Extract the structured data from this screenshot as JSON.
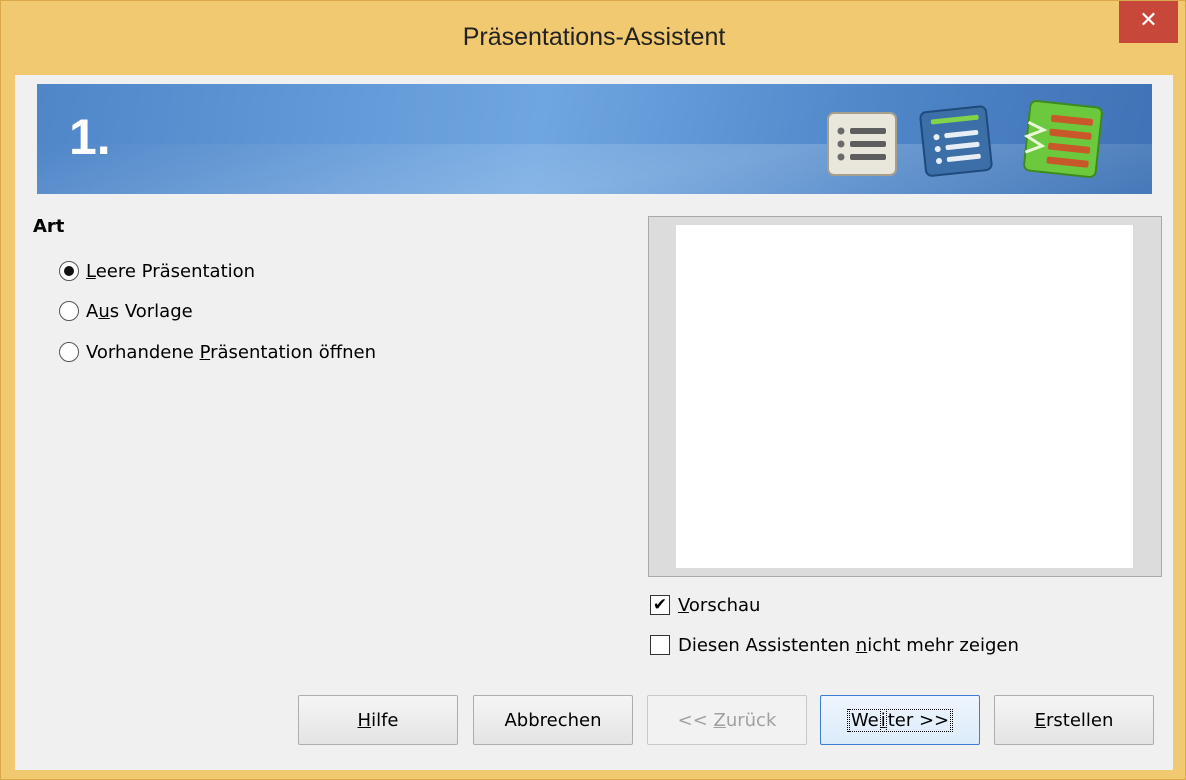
{
  "window": {
    "title": "Präsentations-Assistent",
    "close_glyph": "✕"
  },
  "banner": {
    "step_number": "1."
  },
  "type_section": {
    "label": "Art",
    "options": [
      {
        "pre": "",
        "mnemonic": "L",
        "post": "eere Präsentation",
        "checked": true
      },
      {
        "pre": "A",
        "mnemonic": "u",
        "post": "s Vorlage",
        "checked": false
      },
      {
        "pre": "Vorhandene ",
        "mnemonic": "P",
        "post": "räsentation öffnen",
        "checked": false
      }
    ]
  },
  "preview_checkbox": {
    "pre": "",
    "mnemonic": "V",
    "post": "orschau",
    "checked": true,
    "check_glyph": "✔"
  },
  "dont_show_checkbox": {
    "pre": "Diesen Assistenten ",
    "mnemonic": "n",
    "post": "icht mehr zeigen",
    "checked": false
  },
  "buttons": {
    "help": {
      "pre": "",
      "mnemonic": "H",
      "post": "ilfe"
    },
    "cancel": {
      "label": "Abbrechen"
    },
    "back": {
      "pre": "<< ",
      "mnemonic": "Z",
      "post": "urück"
    },
    "next": {
      "pre": "We",
      "mnemonic": "i",
      "post": "ter >>"
    },
    "create": {
      "pre": "",
      "mnemonic": "E",
      "post": "rstellen"
    }
  },
  "colors": {
    "title_bar": "#f1c971",
    "close_button": "#c7483b",
    "banner": "#5a92d2",
    "step3_icon": "#6cc83c"
  },
  "icons": [
    "list-page-icon",
    "list-page-selected-icon",
    "list-page-green-icon"
  ]
}
